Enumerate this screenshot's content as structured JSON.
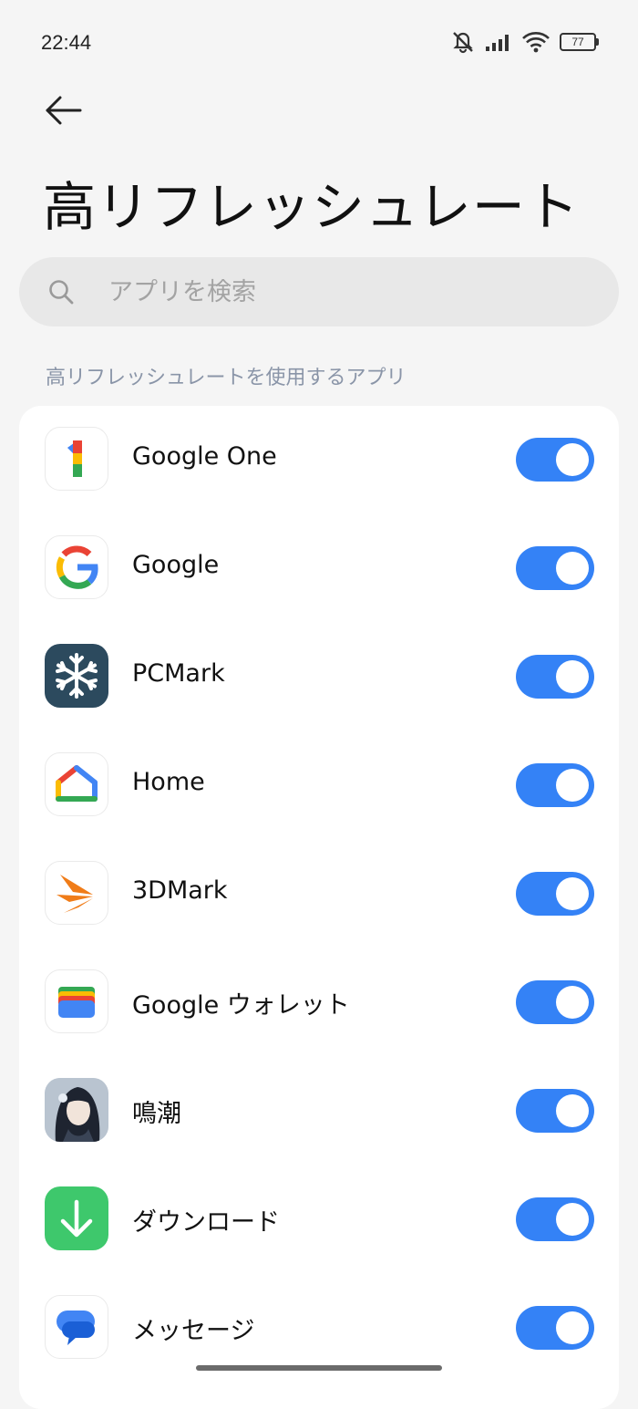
{
  "status_bar": {
    "time": "22:44",
    "battery_level": "77",
    "icons": [
      "mute-icon",
      "signal-icon",
      "wifi-icon",
      "battery-icon"
    ]
  },
  "header": {
    "back_icon": "arrow-left-icon",
    "title": "高リフレッシュレート"
  },
  "search": {
    "placeholder": "アプリを検索",
    "value": "",
    "icon": "search-icon"
  },
  "section": {
    "label": "高リフレッシュレートを使用するアプリ"
  },
  "apps": [
    {
      "name": "Google One",
      "icon": "google-one-icon",
      "enabled": true
    },
    {
      "name": "Google",
      "icon": "google-icon",
      "enabled": true
    },
    {
      "name": "PCMark",
      "icon": "pcmark-icon",
      "enabled": true
    },
    {
      "name": "Home",
      "icon": "google-home-icon",
      "enabled": true
    },
    {
      "name": "3DMark",
      "icon": "3dmark-icon",
      "enabled": true
    },
    {
      "name": "Google ウォレット",
      "icon": "google-wallet-icon",
      "enabled": true
    },
    {
      "name": "鳴潮",
      "icon": "wuthering-waves-icon",
      "enabled": true
    },
    {
      "name": "ダウンロード",
      "icon": "download-icon",
      "enabled": true
    },
    {
      "name": "メッセージ",
      "icon": "messages-icon",
      "enabled": true
    }
  ],
  "colors": {
    "accent": "#3482f6",
    "background": "#f5f5f5",
    "section_label": "#8a95a8"
  }
}
